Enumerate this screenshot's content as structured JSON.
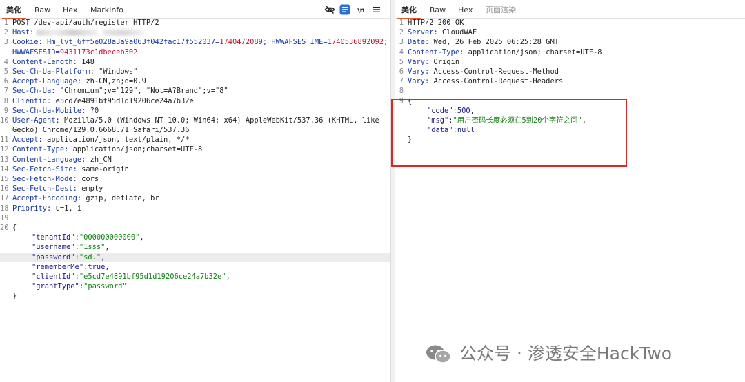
{
  "request": {
    "tabs": [
      {
        "label": "美化",
        "active": true
      },
      {
        "label": "Raw",
        "active": false
      },
      {
        "label": "Hex",
        "active": false
      },
      {
        "label": "MarkInfo",
        "active": false
      }
    ],
    "toolbar_icons": [
      "eye-off-icon",
      "wrap-icon",
      "newline-icon",
      "menu-icon"
    ],
    "lines": {
      "l1": {
        "n": "1",
        "text": "POST /dev-api/auth/register HTTP/2"
      },
      "l2": {
        "n": "2",
        "key": "Host:"
      },
      "l3": {
        "n": "3",
        "key": "Cookie:",
        "c1k": " Hm_lvt_6ff5e028a3a9a063f042fac17f552037=",
        "c1v": "1740472089",
        "c2k": "; HWWAFSESTIME=",
        "c2v": "1740536892092",
        "c3": ";"
      },
      "l3b": {
        "c3k": "HWWAFSESID=",
        "c3v": "9431173c1dbeceb302"
      },
      "l4": {
        "n": "4",
        "key": "Content-Length:",
        "val": " 148"
      },
      "l5": {
        "n": "5",
        "key": "Sec-Ch-Ua-Platform:",
        "val": " \"Windows\""
      },
      "l6": {
        "n": "6",
        "key": "Accept-Language:",
        "val": " zh-CN,zh;q=0.9"
      },
      "l7": {
        "n": "7",
        "key": "Sec-Ch-Ua:",
        "val": " \"Chromium\";v=\"129\", \"Not=A?Brand\";v=\"8\""
      },
      "l8": {
        "n": "8",
        "key": "Clientid:",
        "val": " e5cd7e4891bf95d1d19206ce24a7b32e"
      },
      "l9": {
        "n": "9",
        "key": "Sec-Ch-Ua-Mobile:",
        "val": " ?0"
      },
      "l10": {
        "n": "10",
        "key": "User-Agent:",
        "val": " Mozilla/5.0 (Windows NT 10.0; Win64; x64) AppleWebKit/537.36 (KHTML, like"
      },
      "l10b": {
        "val": "Gecko) Chrome/129.0.6668.71 Safari/537.36"
      },
      "l11": {
        "n": "11",
        "key": "Accept:",
        "val": " application/json, text/plain, */*"
      },
      "l12": {
        "n": "12",
        "key": "Content-Type:",
        "val": " application/json;charset=UTF-8"
      },
      "l13": {
        "n": "13",
        "key": "Content-Language:",
        "val": " zh_CN"
      },
      "l14": {
        "n": "14",
        "key": "Sec-Fetch-Site:",
        "val": " same-origin"
      },
      "l15": {
        "n": "15",
        "key": "Sec-Fetch-Mode:",
        "val": " cors"
      },
      "l16": {
        "n": "16",
        "key": "Sec-Fetch-Dest:",
        "val": " empty"
      },
      "l17": {
        "n": "17",
        "key": "Accept-Encoding:",
        "val": " gzip, deflate, br"
      },
      "l18": {
        "n": "18",
        "key": "Priority:",
        "val": " u=1, i"
      },
      "l19": {
        "n": "19"
      },
      "l20": {
        "n": "20",
        "text": "{"
      },
      "b1": {
        "k": "\"tenantId\"",
        "v": "\"000000000000\"",
        "end": ","
      },
      "b2": {
        "k": "\"username\"",
        "v": "\"1sss\"",
        "end": ","
      },
      "b3": {
        "k": "\"password\"",
        "v": "\"sd.\"",
        "end": ","
      },
      "b4": {
        "k": "\"rememberMe\"",
        "v": "true",
        "end": ","
      },
      "b5": {
        "k": "\"clientId\"",
        "v": "\"e5cd7e4891bf95d1d19206ce24a7b32e\"",
        "end": ","
      },
      "b6": {
        "k": "\"grantType\"",
        "v": "\"password\"",
        "end": ""
      },
      "close": "}"
    }
  },
  "response": {
    "tabs": [
      {
        "label": "美化",
        "active": true
      },
      {
        "label": "Raw",
        "active": false
      },
      {
        "label": "Hex",
        "active": false
      },
      {
        "label": "页面渲染",
        "active": false
      }
    ],
    "lines": {
      "l1": {
        "n": "1",
        "text": "HTTP/2 200 OK"
      },
      "l2": {
        "n": "2",
        "key": "Server:",
        "val": " CloudWAF"
      },
      "l3": {
        "n": "3",
        "key": "Date:",
        "val": " Wed, 26 Feb 2025 06:25:28 GMT"
      },
      "l4": {
        "n": "4",
        "key": "Content-Type:",
        "val": " application/json; charset=UTF-8"
      },
      "l5": {
        "n": "5",
        "key": "Vary:",
        "val": " Origin"
      },
      "l6": {
        "n": "6",
        "key": "Vary:",
        "val": " Access-Control-Request-Method"
      },
      "l7": {
        "n": "7",
        "key": "Vary:",
        "val": " Access-Control-Request-Headers"
      },
      "l8": {
        "n": "8"
      },
      "l9": {
        "n": "9",
        "text": "{"
      },
      "b1": {
        "k": "\"code\"",
        "v": "500",
        "end": ","
      },
      "b2": {
        "k": "\"msg\"",
        "v": "\"用户密码长度必须在5到20个字符之间\"",
        "end": ","
      },
      "b3": {
        "k": "\"data\"",
        "v": "null",
        "end": ""
      },
      "close": "}"
    }
  },
  "watermark": {
    "text": "公众号 · 渗透安全HackTwo"
  },
  "colors": {
    "accent": "#e3562b",
    "highlight_box": "#e02525"
  }
}
